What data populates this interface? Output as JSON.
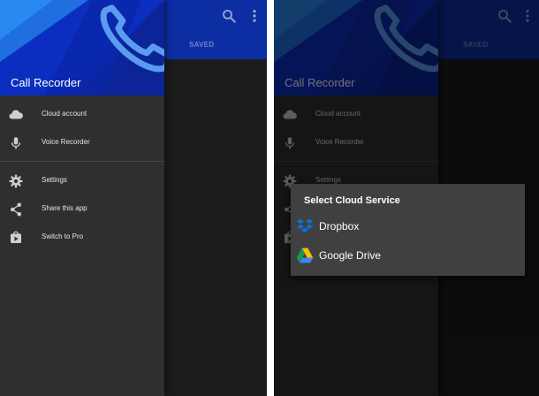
{
  "app": {
    "title": "Call Recorder",
    "tab_saved": "SAVED"
  },
  "drawer": {
    "items": [
      {
        "label": "Cloud account",
        "icon": "cloud-icon"
      },
      {
        "label": "Voice Recorder",
        "icon": "microphone-icon"
      },
      {
        "label": "Settings",
        "icon": "gear-icon"
      },
      {
        "label": "Share this app",
        "icon": "share-icon"
      },
      {
        "label": "Switch to Pro",
        "icon": "shop-icon"
      }
    ]
  },
  "dialog": {
    "title": "Select Cloud Service",
    "options": [
      {
        "label": "Dropbox",
        "icon": "dropbox-icon"
      },
      {
        "label": "Google Drive",
        "icon": "google-drive-icon"
      }
    ]
  },
  "colors": {
    "appbar": "#0d2ea3",
    "drawer_header": "#0c2ec0",
    "drawer_bg": "#2f2f2f",
    "dialog_bg": "#404040",
    "dropbox_blue": "#0d6fd3"
  }
}
